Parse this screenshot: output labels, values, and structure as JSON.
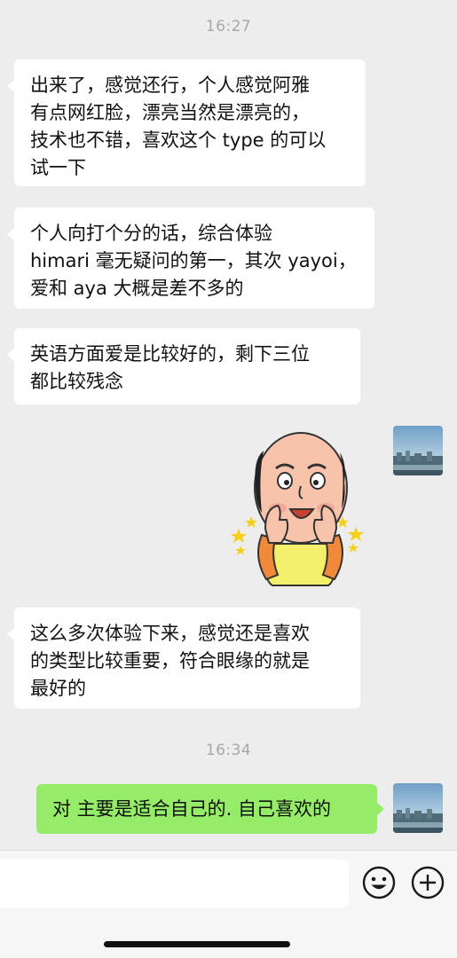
{
  "chat": {
    "timestamps": [
      "16:27",
      "16:34"
    ],
    "messages": [
      {
        "sender": "other",
        "lines": [
          "出来了，感觉还行，个人感觉阿雅",
          "有点网红脸，漂亮当然是漂亮的，",
          "技术也不错，喜欢这个 type 的可以",
          "试一下"
        ]
      },
      {
        "sender": "other",
        "lines": [
          "个人向打个分的话，综合体验",
          "himari 毫无疑问的第一，其次 yayoi，",
          "爱和 aya 大概是差不多的"
        ]
      },
      {
        "sender": "other",
        "lines": [
          "英语方面爱是比较好的，剩下三位",
          "都比较残念"
        ]
      },
      {
        "sender": "self",
        "type": "sticker",
        "sticker": "bald-man-thumbs-up-sticker"
      },
      {
        "sender": "other",
        "lines": [
          "这么多次体验下来，感觉还是喜欢",
          "的类型比较重要，符合眼缘的就是",
          "最好的"
        ]
      },
      {
        "sender": "self",
        "lines": [
          "对 主要是适合自己的. 自己喜欢的"
        ]
      }
    ]
  },
  "input_bar": {
    "value": "",
    "emoji_icon": "emoji-icon",
    "add_icon": "plus-icon"
  },
  "colors": {
    "background": "#ededed",
    "bubble_other": "#ffffff",
    "bubble_self": "#95ec69",
    "timestamp": "#a8a8a8"
  }
}
